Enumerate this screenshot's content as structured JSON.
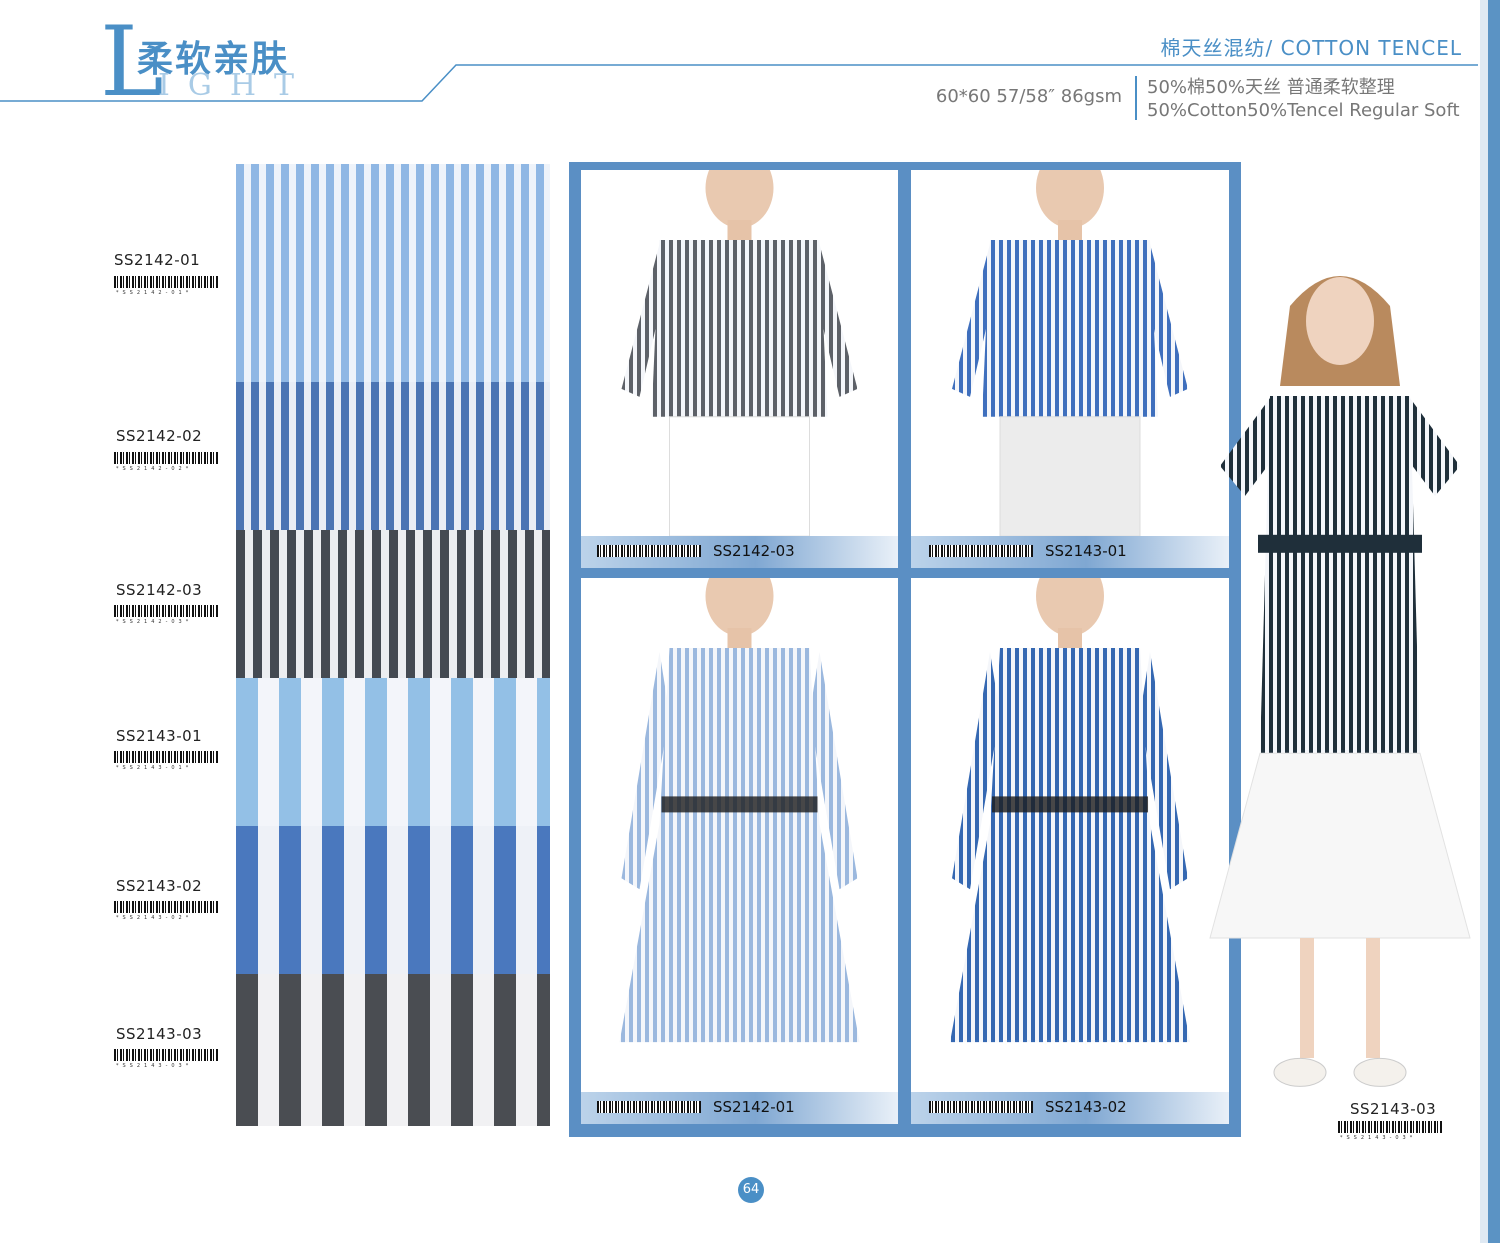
{
  "header": {
    "logo_letter": "L",
    "logo_cn": "柔软亲肤",
    "logo_en": "IGHT",
    "title": "棉天丝混纺/ COTTON TENCEL",
    "spec": "60*60 57/58″ 86gsm",
    "composition_cn": "50%棉50%天丝  普通柔软整理",
    "composition_en": "50%Cotton50%Tencel  Regular Soft"
  },
  "swatches": [
    {
      "code": "SS2142-01",
      "barcode_digits": "*SS2142-01*",
      "stripe": "#8fb7e4",
      "ground": "#eef3fa",
      "pitch": 15
    },
    {
      "code": "SS2142-02",
      "barcode_digits": "*SS2142-02*",
      "stripe": "#4a74b4",
      "ground": "#e8edf6",
      "pitch": 15
    },
    {
      "code": "SS2142-03",
      "barcode_digits": "*SS2142-03*",
      "stripe": "#444a52",
      "ground": "#eceef1",
      "pitch": 17
    },
    {
      "code": "SS2143-01",
      "barcode_digits": "*SS2143-01*",
      "stripe": "#93c0e6",
      "ground": "#f3f5fa",
      "pitch": 43
    },
    {
      "code": "SS2143-02",
      "barcode_digits": "*SS2143-02*",
      "stripe": "#4a78be",
      "ground": "#eef1f7",
      "pitch": 43
    },
    {
      "code": "SS2143-03",
      "barcode_digits": "*SS2143-03*",
      "stripe": "#4a4d52",
      "ground": "#f1f1f3",
      "pitch": 43
    }
  ],
  "photos": [
    {
      "code": "SS2142-03",
      "barcode_digits": "*SS2142-03*",
      "garment": "#5d6168",
      "bottom": "#ffffff"
    },
    {
      "code": "SS2143-01",
      "barcode_digits": "*SS2143-01*",
      "garment": "#3f6fbd",
      "bottom": "#ececec"
    },
    {
      "code": "SS2142-01",
      "barcode_digits": "*SS2142-01*",
      "garment": "#9bb8de",
      "bottom": "#9bb8de"
    },
    {
      "code": "SS2143-02",
      "barcode_digits": "*SS2143-02*",
      "garment": "#3568b2",
      "bottom": "#3568b2"
    }
  ],
  "model": {
    "code": "SS2143-03",
    "barcode_digits": "*SS2143-03*",
    "garment": "#1f2f3a"
  },
  "page_number": "64"
}
